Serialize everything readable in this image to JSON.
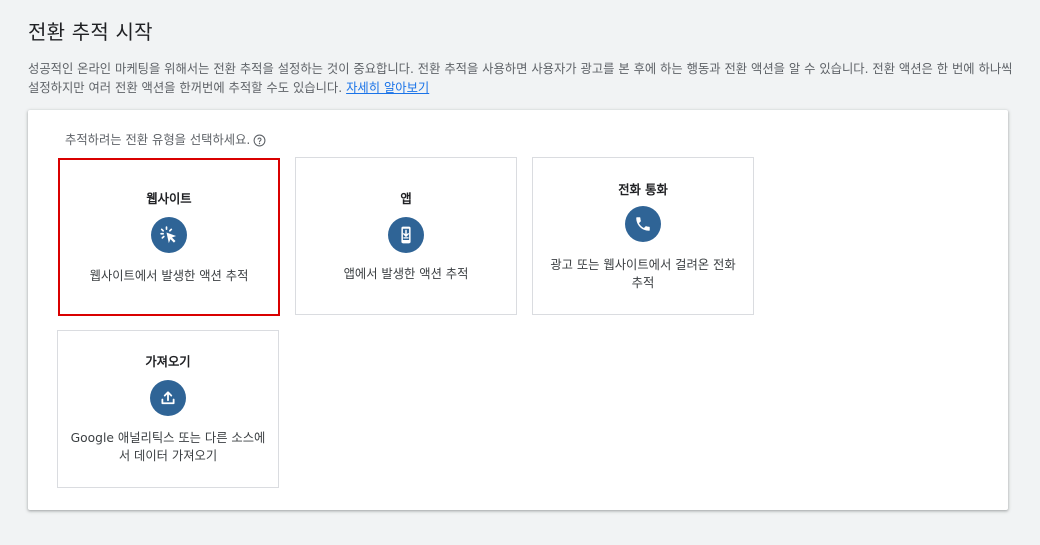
{
  "header": {
    "title": "전환 추적 시작",
    "intro_text": "성공적인 온라인 마케팅을 위해서는 전환 추적을 설정하는 것이 중요합니다. 전환 추적을 사용하면 사용자가 광고를 본 후에 하는 행동과 전환 액션을 알 수 있습니다. 전환 액션은 한 번에 하나씩 설정하지만 여러 전환 액션을 한꺼번에 추적할 수도 있습니다.",
    "learn_more_link": "자세히 알아보기"
  },
  "panel": {
    "prompt": "추적하려는 전환 유형을 선택하세요.",
    "help_icon": "help-circle-icon",
    "cards": [
      {
        "title": "웹사이트",
        "icon": "click-cursor-icon",
        "description": "웹사이트에서 발생한 액션 추적",
        "selected": true
      },
      {
        "title": "앱",
        "icon": "mobile-download-icon",
        "description": "앱에서 발생한 액션 추적",
        "selected": false
      },
      {
        "title": "전화 통화",
        "icon": "phone-icon",
        "description": "광고 또는 웹사이트에서 걸려온 전화 추적",
        "selected": false
      },
      {
        "title": "가져오기",
        "icon": "upload-icon",
        "description": "Google 애널리틱스 또는 다른 소스에서 데이터 가져오기",
        "selected": false
      }
    ]
  },
  "colors": {
    "background": "#f1f3f4",
    "icon_circle": "#2f6496",
    "selected_border": "#d90000",
    "link": "#1a73e8"
  }
}
